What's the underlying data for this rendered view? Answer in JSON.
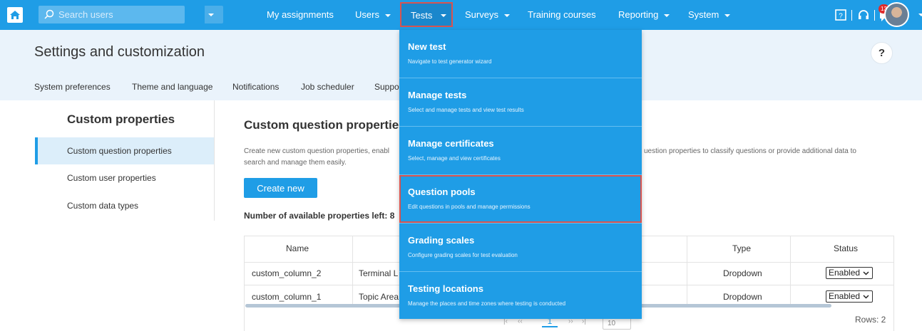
{
  "topbar": {
    "search_placeholder": "Search users",
    "nav": {
      "my_assignments": "My assignments",
      "users": "Users",
      "tests": "Tests",
      "surveys": "Surveys",
      "training_courses": "Training courses",
      "reporting": "Reporting",
      "system": "System"
    },
    "notification_count": "13",
    "colors": {
      "bar": "#1f9de6",
      "highlight_border": "#d9534f"
    }
  },
  "header": {
    "title": "Settings and customization",
    "help": "?",
    "tabs": [
      "System preferences",
      "Theme and language",
      "Notifications",
      "Job scheduler",
      "Suppo"
    ]
  },
  "sidebar": {
    "title": "Custom properties",
    "items": [
      {
        "label": "Custom question properties",
        "active": true
      },
      {
        "label": "Custom user properties",
        "active": false
      },
      {
        "label": "Custom data types",
        "active": false
      }
    ]
  },
  "main": {
    "title": "Custom question properties",
    "description_line1": "Create new custom question properties, enabl",
    "description_line2": "search and manage them easily.",
    "description_right": "uestion properties to classify questions or provide additional data to",
    "create_button": "Create new",
    "available_text": "Number of available properties left: 8",
    "table": {
      "headers": [
        "Name",
        "Type",
        "Status"
      ],
      "rows": [
        {
          "name": "custom_column_2",
          "label": "Terminal L",
          "type": "Dropdown",
          "status": "Enabled"
        },
        {
          "name": "custom_column_1",
          "label": "Topic Area",
          "type": "Dropdown",
          "status": "Enabled"
        }
      ],
      "pager_current": "1",
      "per_page": "10",
      "rows_count": "Rows: 2"
    }
  },
  "dropdown": {
    "items": [
      {
        "title": "New test",
        "subtitle": "Navigate to test generator wizard",
        "highlighted": false
      },
      {
        "title": "Manage tests",
        "subtitle": "Select and manage tests and view test results",
        "highlighted": false
      },
      {
        "title": "Manage certificates",
        "subtitle": "Select, manage and view certificates",
        "highlighted": false
      },
      {
        "title": "Question pools",
        "subtitle": "Edit questions in pools and manage permissions",
        "highlighted": true
      },
      {
        "title": "Grading scales",
        "subtitle": "Configure grading scales for test evaluation",
        "highlighted": false
      },
      {
        "title": "Testing locations",
        "subtitle": "Manage the places and time zones where testing is conducted",
        "highlighted": false
      }
    ]
  }
}
